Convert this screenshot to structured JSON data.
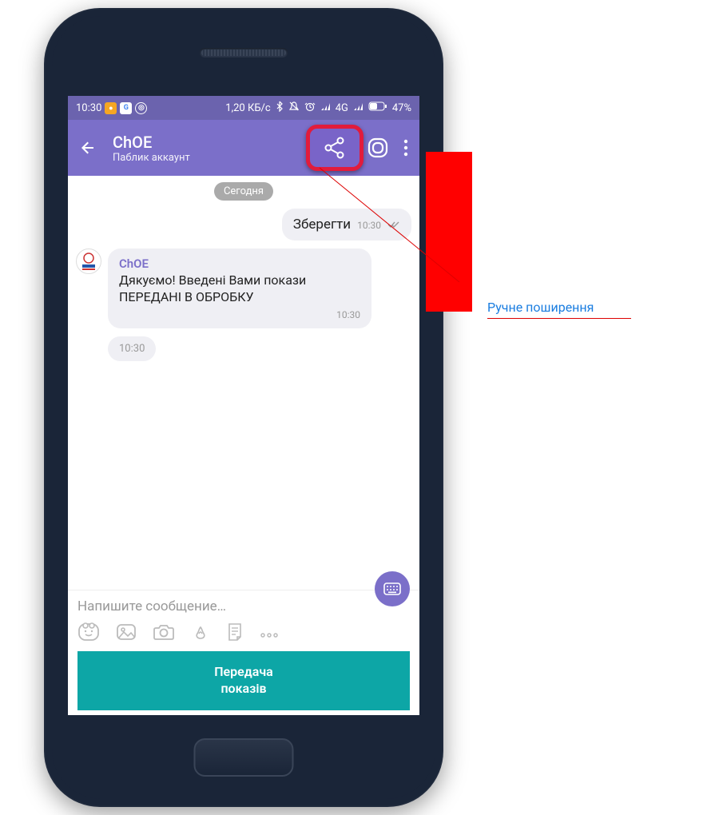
{
  "status": {
    "time": "10:30",
    "data_speed": "1,20 КБ/с",
    "network_label": "4G",
    "battery": "47%"
  },
  "header": {
    "title": "ChOE",
    "subtitle": "Паблик аккаунт"
  },
  "chat": {
    "date_label": "Сегодня",
    "outgoing": {
      "text": "Зберегти",
      "time": "10:30"
    },
    "incoming": {
      "sender": "ChOE",
      "body": "Дякуємо! Введені Вами покази ПЕРЕДАНІ В ОБРОБКУ",
      "time": "10:30"
    },
    "extra_time": "10:30"
  },
  "input": {
    "placeholder": "Напишите сообщение…"
  },
  "action_button": {
    "line1": "Передача",
    "line2": "показів"
  },
  "callout": {
    "text": "Ручне поширення"
  },
  "colors": {
    "viber_purple": "#7B6FC9",
    "status_purple": "#6B63AE",
    "teal": "#0DA6A6",
    "highlight_red": "#e21b3c"
  }
}
